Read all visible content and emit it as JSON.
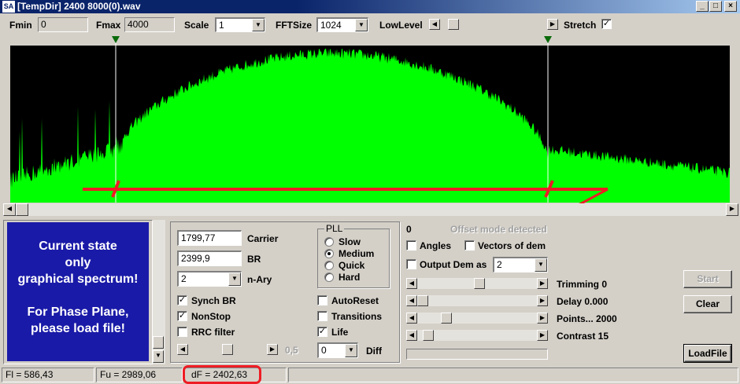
{
  "window": {
    "icon_label": "SA",
    "title": "[TempDir] 2400 8000(0).wav",
    "btn_min": "_",
    "btn_max": "□",
    "btn_close": "×"
  },
  "toolbar": {
    "fmin_label": "Fmin",
    "fmin_value": "0",
    "fmax_label": "Fmax",
    "fmax_value": "4000",
    "scale_label": "Scale",
    "scale_value": "1",
    "fftsize_label": "FFTSize",
    "fftsize_value": "1024",
    "lowlevel_label": "LowLevel",
    "lowlevel_level": 0.08,
    "stretch_label": "Stretch",
    "stretch_checked": "✓"
  },
  "spectrum": {
    "background": "#000000",
    "fill_color": "#00ff00",
    "marker_color": "#ff0000",
    "markers_hz": [
      586.43,
      2989.06
    ],
    "freq_range_hz": [
      0,
      4000
    ],
    "h_scroll_position": 0.0
  },
  "state_panel": {
    "line1": "Current state",
    "line2": "only",
    "line3": "graphical spectrum!",
    "line4": "For Phase Plane,",
    "line5": "please load file!",
    "bg_color": "#1a1aa8"
  },
  "params": {
    "carrier_value": "1799,77",
    "carrier_label": "Carrier",
    "br_value": "2399,9",
    "br_label": "BR",
    "nary_value": "2",
    "nary_label": "n-Ary",
    "synch_br_label": "Synch BR",
    "synch_br_checked": "✓",
    "nonstop_label": "NonStop",
    "nonstop_checked": "✓",
    "rrc_label": "RRC filter",
    "rrc_checked": "",
    "rrc_value": "0,5",
    "rrc_level": 0.5
  },
  "pll": {
    "title": "PLL",
    "options": [
      "Slow",
      "Medium",
      "Quick",
      "Hard"
    ],
    "selected": "Medium",
    "autoreset_label": "AutoReset",
    "autoreset_checked": "",
    "transitions_label": "Transitions",
    "transitions_checked": "",
    "life_label": "Life",
    "life_checked": "✓",
    "diff_value": "0",
    "diff_label": "Diff"
  },
  "demod": {
    "zero_label": "0",
    "offset_text": "Offset mode detected",
    "angles_label": "Angles",
    "angles_checked": "",
    "vectors_label": "Vectors of dem",
    "vectors_checked": "",
    "output_dem_label": "Output Dem as",
    "output_dem_checked": "",
    "output_dem_value": "2",
    "trimming_label": "Trimming 0",
    "trimming_level": 0.52,
    "delay_label": "Delay  0.000",
    "delay_level": 0.0,
    "points_label": "Points... 2000",
    "points_level": 0.22,
    "contrast_label": "Contrast 15",
    "contrast_level": 0.05
  },
  "buttons": {
    "start": "Start",
    "clear": "Clear",
    "loadfile": "LoadFile"
  },
  "status": {
    "fl": "Fl = 586,43",
    "fu": "Fu = 2989,06",
    "df": "dF = 2402,63"
  }
}
